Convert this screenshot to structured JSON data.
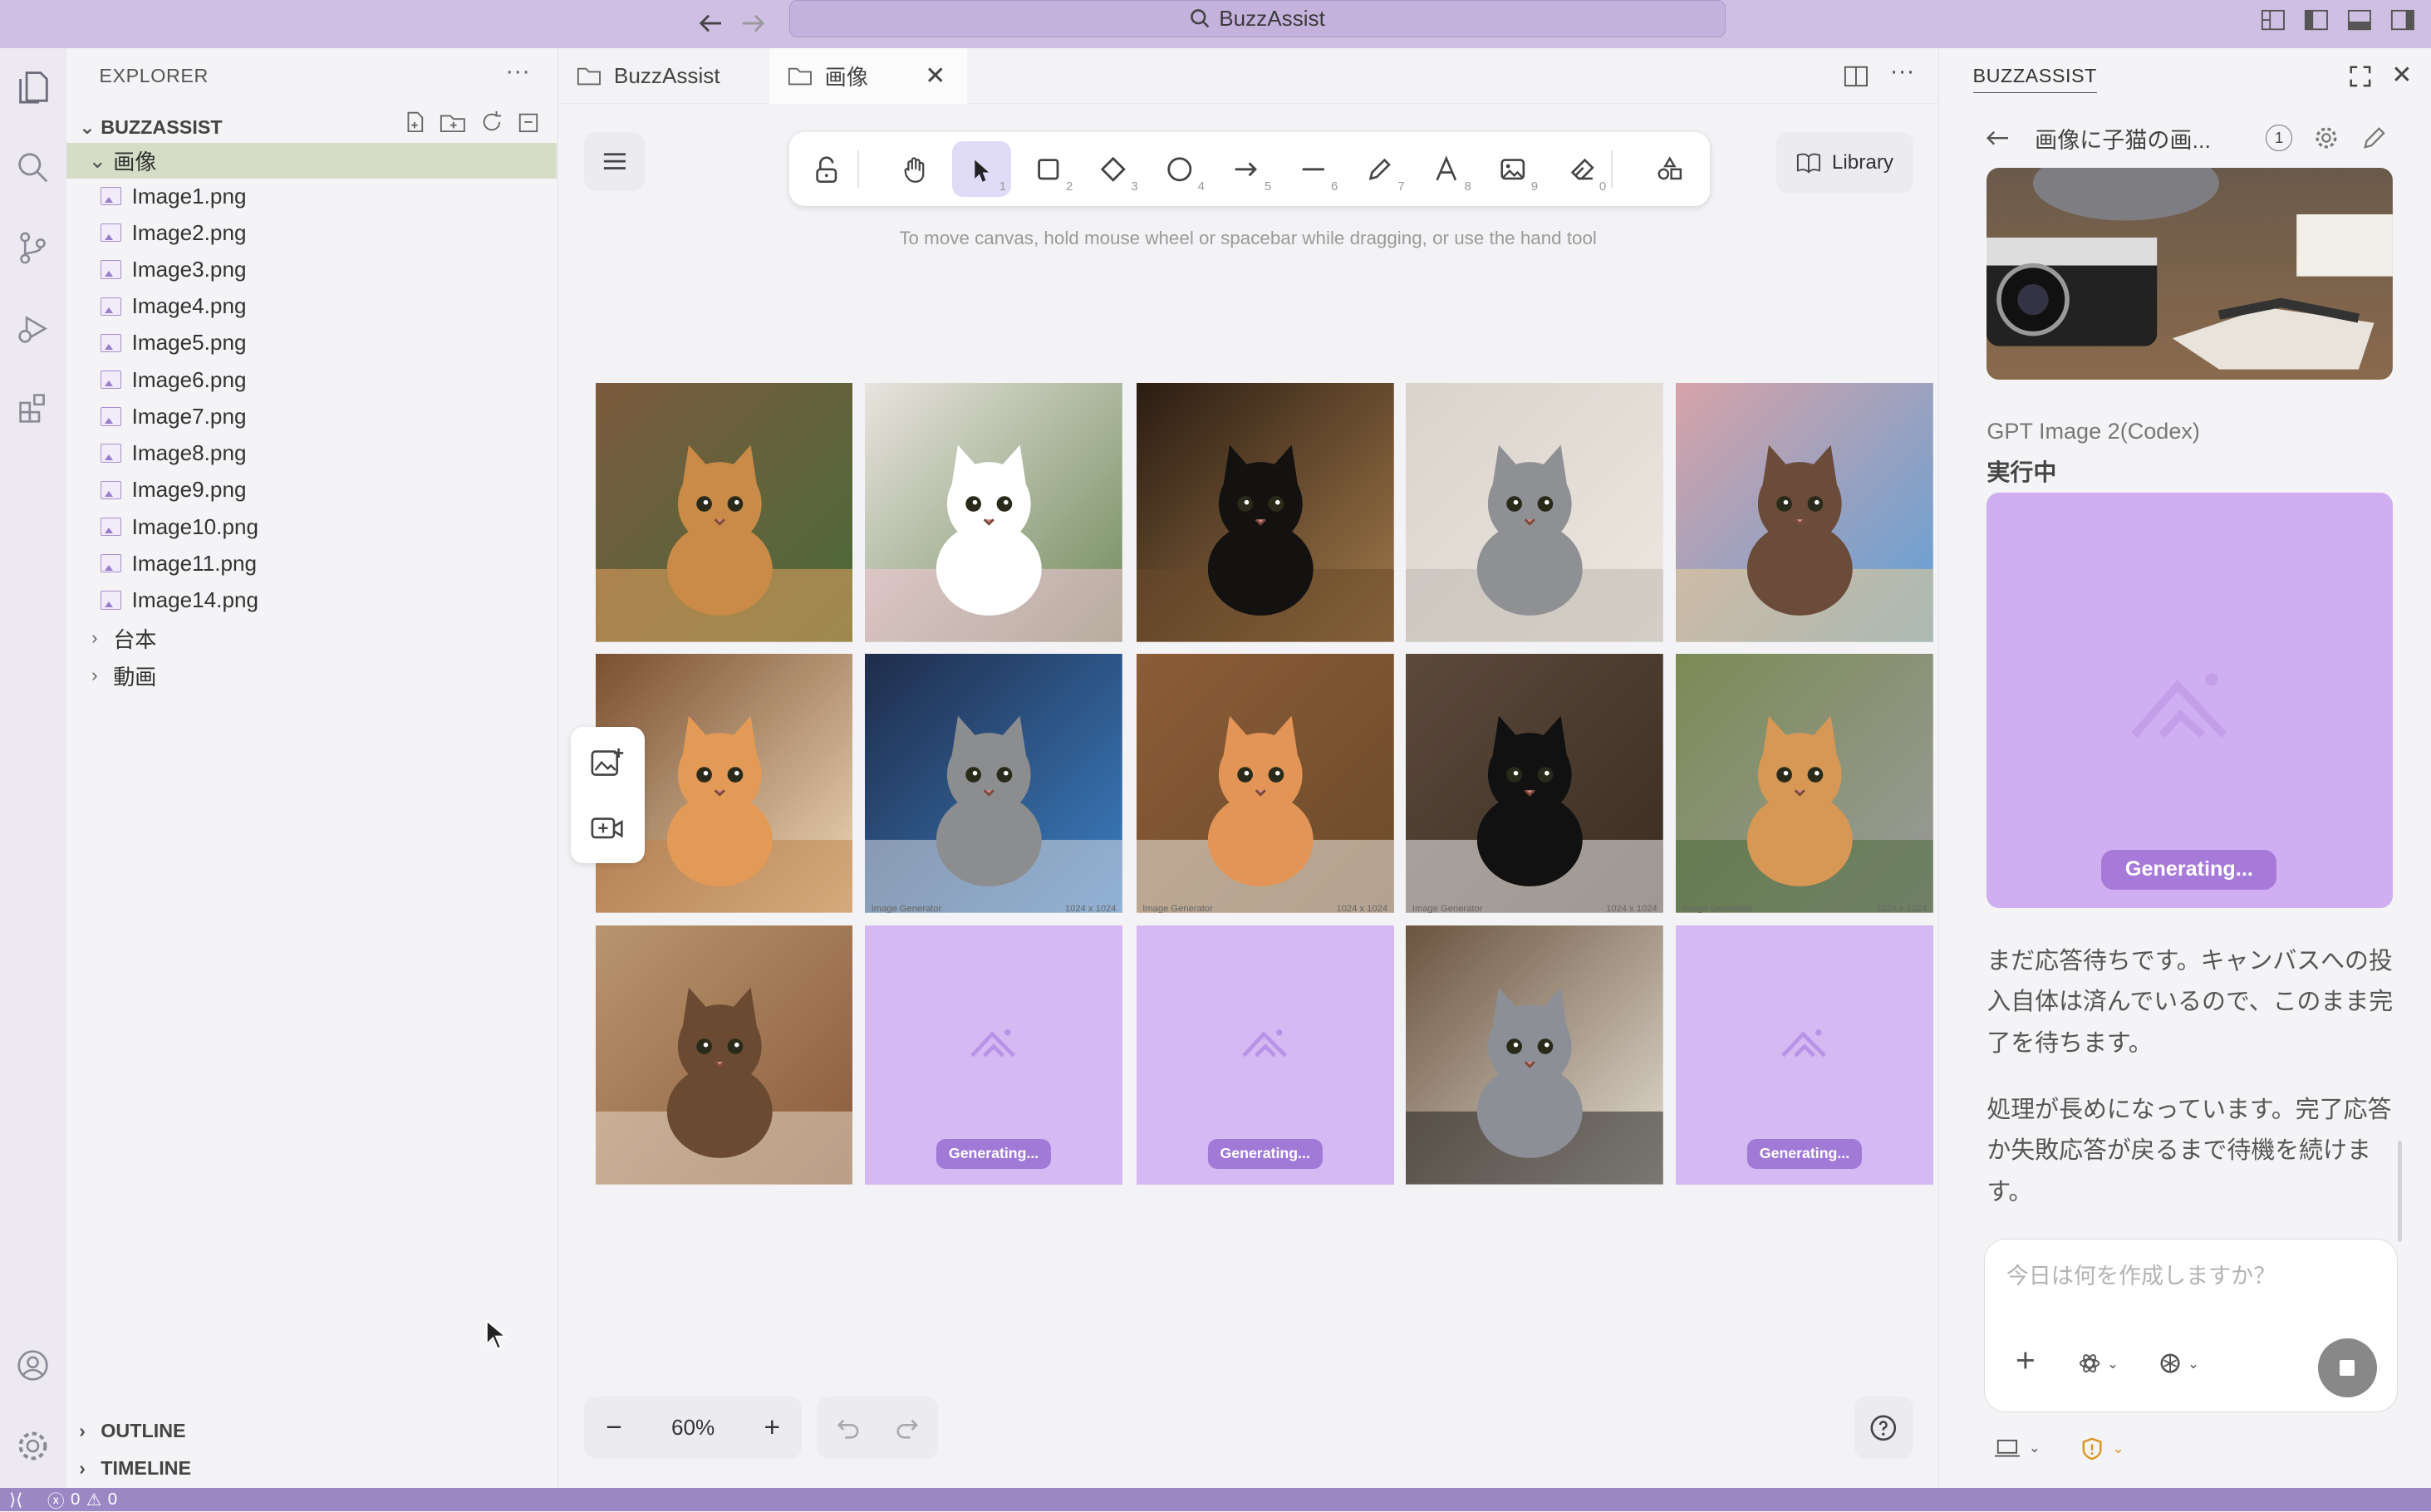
{
  "window": {
    "command_center": "BuzzAssist"
  },
  "explorer": {
    "title": "EXPLORER",
    "root": "BUZZASSIST",
    "folder_open": "画像",
    "files": [
      "Image1.png",
      "Image2.png",
      "Image3.png",
      "Image4.png",
      "Image5.png",
      "Image6.png",
      "Image7.png",
      "Image8.png",
      "Image9.png",
      "Image10.png",
      "Image11.png",
      "Image14.png"
    ],
    "folders_closed": [
      "台本",
      "動画"
    ],
    "outline": "OUTLINE",
    "timeline": "TIMELINE"
  },
  "tabs": [
    {
      "label": "BuzzAssist"
    },
    {
      "label": "画像"
    }
  ],
  "canvas": {
    "hint": "To move canvas, hold mouse wheel or spacebar while dragging, or use the hand tool",
    "library_label": "Library",
    "zoom": "60%",
    "tool_numbers": [
      "1",
      "2",
      "3",
      "4",
      "5",
      "6",
      "7",
      "8",
      "9",
      "0"
    ],
    "generating_label": "Generating...",
    "tile_caption": "Image Generator",
    "tile_size": "1024 x 1024",
    "tiles": [
      {
        "kind": "photo",
        "theme": "orange kitten in study"
      },
      {
        "kind": "photo",
        "theme": "white kitten with brushes"
      },
      {
        "kind": "photo",
        "theme": "black kitten with books"
      },
      {
        "kind": "photo",
        "theme": "grey kitten sleeping"
      },
      {
        "kind": "photo",
        "theme": "calico kitten party"
      },
      {
        "kind": "photo",
        "theme": "orange kitten with guitar"
      },
      {
        "kind": "photo",
        "theme": "tabby kitten with rocket"
      },
      {
        "kind": "photo",
        "theme": "orange kitten baking"
      },
      {
        "kind": "photo",
        "theme": "tuxedo kitten chess"
      },
      {
        "kind": "photo",
        "theme": "kitten gardener"
      },
      {
        "kind": "photo",
        "theme": "tabby kitten with cocoa"
      },
      {
        "kind": "generating"
      },
      {
        "kind": "generating"
      },
      {
        "kind": "photo",
        "theme": "grey kitten with camera"
      },
      {
        "kind": "generating"
      }
    ]
  },
  "assistant": {
    "title": "BUZZASSIST",
    "thread_title": "画像に子猫の画...",
    "thread_badge": "1",
    "model": "GPT Image 2(Codex)",
    "status": "実行中",
    "generating_label": "Generating...",
    "messages": [
      "まだ応答待ちです。キャンバスへの投入自体は済んでいるので、このまま完了を待ちます。",
      "処理が長めになっています。完了応答か失敗応答が戻るまで待機を続けます。"
    ],
    "input_placeholder": "今日は何を作成しますか？"
  },
  "statusbar": {
    "errors": "0",
    "warnings": "0"
  }
}
